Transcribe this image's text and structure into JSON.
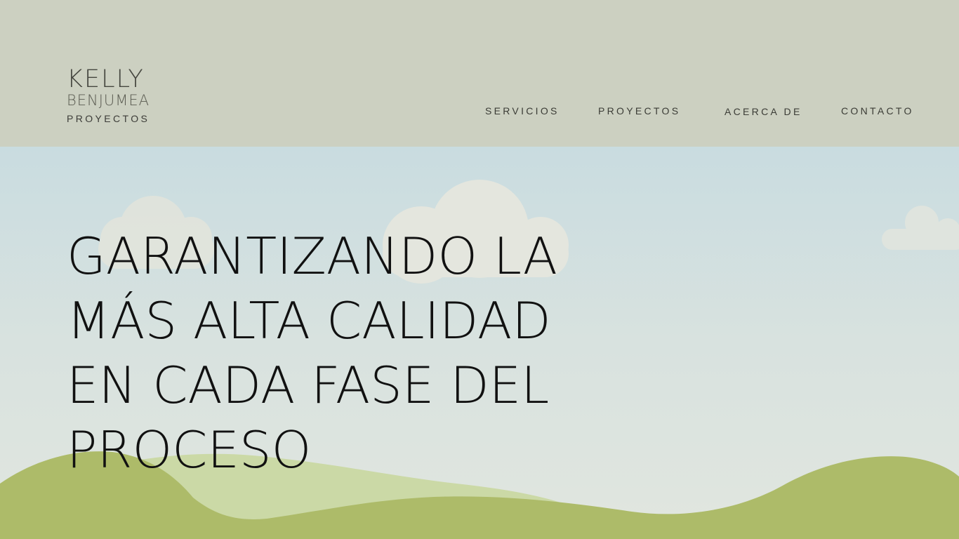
{
  "header": {
    "background": "#ccd0c1",
    "logo": {
      "line1": "KELLY",
      "line2": "BENJUMEA",
      "line3": "PROYECTOS"
    },
    "nav": [
      {
        "label": "SERVICIOS"
      },
      {
        "label": "PROYECTOS"
      },
      {
        "label": "ACERCA DE"
      },
      {
        "label": "CONTACTO"
      }
    ]
  },
  "hero": {
    "headline_lines": [
      "GARANTIZANDO LA",
      "MÁS ALTA CALIDAD",
      "EN CADA FASE DEL",
      "PROCESO"
    ],
    "colors": {
      "sky_top": "#c9dce0",
      "sky_bottom": "#e1e6df",
      "cloud": "#e4e6df",
      "hill_dark": "#adbb69",
      "hill_light": "#cbd9a6"
    },
    "icons": [
      "cloud-icon",
      "cloud-icon",
      "cloud-icon",
      "hills-illustration"
    ]
  }
}
